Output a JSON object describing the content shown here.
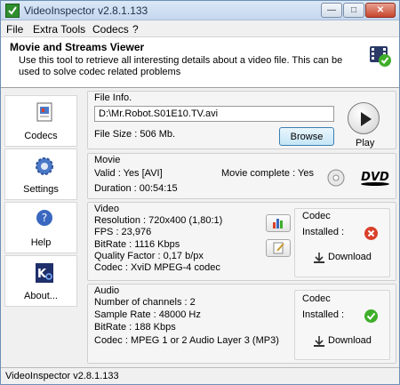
{
  "window": {
    "title": "VideoInspector v2.8.1.133"
  },
  "menu": [
    "File",
    "Extra Tools",
    "Codecs",
    "?"
  ],
  "header": {
    "title": "Movie and Streams Viewer",
    "description": "Use this tool to retrieve all interesting details about a video file. This can be used to solve codec related problems"
  },
  "sidebar": [
    {
      "label": "Codecs",
      "icon": "codecs-icon"
    },
    {
      "label": "Settings",
      "icon": "gear-icon"
    },
    {
      "label": "Help",
      "icon": "help-icon"
    },
    {
      "label": "About...",
      "icon": "about-icon"
    }
  ],
  "file_info": {
    "title": "File Info.",
    "path": "D:\\Mr.Robot.S01E10.TV.avi",
    "size": "File Size : 506 Mb.",
    "browse": "Browse",
    "play": "Play"
  },
  "movie": {
    "title": "Movie",
    "valid": "Valid : Yes [AVI]",
    "duration": "Duration : 00:54:15",
    "complete": "Movie complete : Yes",
    "dvd_logo": "DVD"
  },
  "video": {
    "title": "Video",
    "resolution": "Resolution : 720x400 (1,80:1)",
    "fps": "FPS : 23,976",
    "bitrate": "BitRate : 1116 Kbps",
    "quality": "Quality Factor : 0,17 b/px",
    "codec": "Codec : XviD MPEG-4 codec",
    "codec_box": {
      "title": "Codec",
      "installed": "Installed :",
      "download": "Download"
    }
  },
  "audio": {
    "title": "Audio",
    "channels": "Number of channels : 2",
    "sample_rate": "Sample Rate : 48000 Hz",
    "bitrate": "BitRate : 188 Kbps",
    "codec": "Codec : MPEG 1 or 2 Audio Layer 3 (MP3)",
    "codec_box": {
      "title": "Codec",
      "installed": "Installed :",
      "download": "Download"
    }
  },
  "status_bar": "VideoInspector v2.8.1.133",
  "colors": {
    "not_installed": "#d9412b",
    "installed": "#3fae2a",
    "accent": "#3c7fb1"
  }
}
